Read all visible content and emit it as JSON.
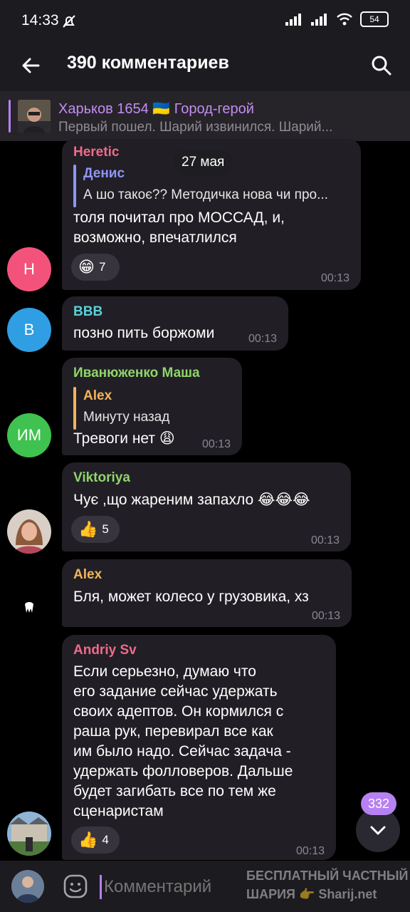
{
  "status_bar": {
    "time": "14:33",
    "battery": "54"
  },
  "header": {
    "title": "390 комментариев"
  },
  "pinned": {
    "title": "Харьков 1654 🇺🇦 Город-герой",
    "text": "Первый пошел. Шарий извинился.   Шарий..."
  },
  "date_pill": "27 мая",
  "messages": [
    {
      "author": "Heretic",
      "author_color": "#f06a8c",
      "avatar_text": "H",
      "avatar_color": "#f3537b",
      "reply_to": {
        "name": "Денис",
        "text": "А шо такоє?? Методичка нова чи про...",
        "color": "#8f95f7"
      },
      "text": "толя почитал про МОССАД, и,\nвозможно, впечатлился",
      "reaction": {
        "emoji": "😁",
        "count": "7"
      },
      "time": "00:13"
    },
    {
      "author": "BBB",
      "author_color": "#5ad0d8",
      "avatar_text": "B",
      "avatar_color": "#2f9ee3",
      "text": "позно пить боржоми",
      "time": "00:13"
    },
    {
      "author": "Иванюженко Маша",
      "author_color": "#8fd56a",
      "avatar_text": "ИМ",
      "avatar_color": "#3fc24f",
      "reply_to": {
        "name": "Alex",
        "text": "Минуту назад",
        "color": "#f2b45c"
      },
      "text": "Тревоги нет 😩",
      "time": "00:13"
    },
    {
      "author": "Viktoriya",
      "author_color": "#8fd56a",
      "text": "Чує ,що жареним запахло 😂😂😂",
      "reaction": {
        "emoji": "👍",
        "count": "5"
      },
      "time": "00:13"
    },
    {
      "author": "Alex",
      "author_color": "#f2b45c",
      "text": "Бля, может колесо у грузовика, хз",
      "time": "00:13"
    },
    {
      "author": "Andriy Sv",
      "author_color": "#f06a8c",
      "text": "Если серьезно, думаю что\nего задание сейчас удержать\nсвоих адептов. Он кормился с\nраша рук, перевирал все как\nим было надо. Сейчас задача -\nудержать фолловеров. Дальше\nбудет загибать все по тем же\nсценаристам",
      "reaction": {
        "emoji": "👍",
        "count": "4"
      },
      "time": "00:13"
    }
  ],
  "unread_badge": "332",
  "input": {
    "placeholder": "Комментарий"
  },
  "watermark": {
    "line1": "БЕСПЛАТНЫЙ ЧАСТНЫЙ",
    "line2": "ШАРИЯ 👉 Sharij.net"
  },
  "colors": {
    "accent": "#b681f2",
    "bubble": "#211f25",
    "background": "#000000"
  }
}
